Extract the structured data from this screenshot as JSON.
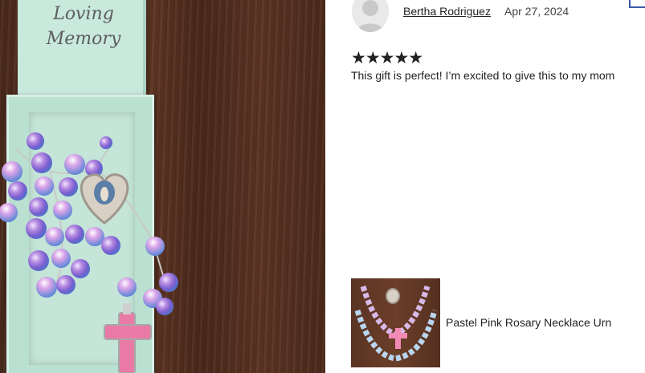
{
  "photo": {
    "box_text_line1": "Loving",
    "box_text_line2": "Memory"
  },
  "review": {
    "reviewer_name": "Bertha Rodriguez",
    "date": "Apr 27, 2024",
    "rating": 5,
    "stars": "★★★★★",
    "text": "This gift is perfect! I’m excited to give this to my mom"
  },
  "product": {
    "name": "Pastel Pink Rosary Necklace Urn"
  },
  "colors": {
    "accent_border": "#3b5aa8",
    "cross_pink": "#e97aa6",
    "box_mint": "#b9e0d0"
  }
}
